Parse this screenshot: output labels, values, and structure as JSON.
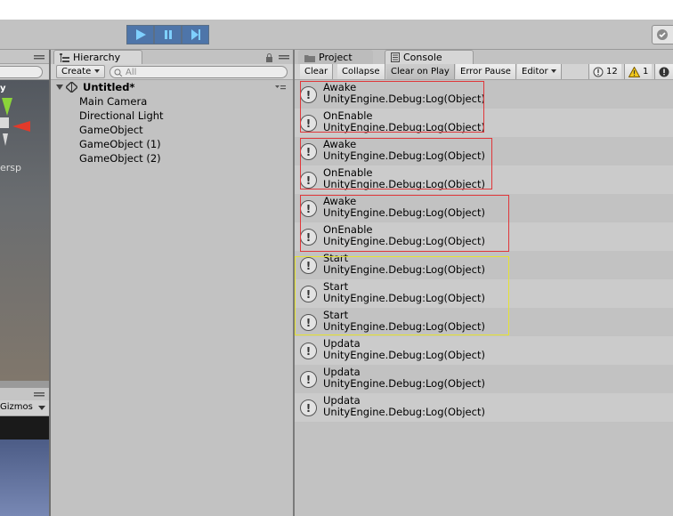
{
  "highlight_colors": {
    "red": "#e0373a",
    "yellow": "#e6e32f"
  },
  "hierarchy": {
    "tab_label": "Hierarchy",
    "create_label": "Create",
    "search_placeholder": "All",
    "scene_name": "Untitled*",
    "items": [
      "Main Camera",
      "Directional Light",
      "GameObject",
      "GameObject (1)",
      "GameObject (2)"
    ]
  },
  "scene_panel": {
    "persp_label": "ersp",
    "axis_label": "y",
    "gizmos_label": "Gizmos"
  },
  "console": {
    "project_tab": "Project",
    "console_tab": "Console",
    "buttons": [
      "Clear",
      "Collapse",
      "Clear on Play",
      "Error Pause",
      "Editor"
    ],
    "log_count": "12",
    "warn_count": "1",
    "entries": [
      {
        "message": "Awake",
        "detail": "UnityEngine.Debug:Log(Object)"
      },
      {
        "message": "OnEnable",
        "detail": "UnityEngine.Debug:Log(Object)"
      },
      {
        "message": "Awake",
        "detail": "UnityEngine.Debug:Log(Object)"
      },
      {
        "message": "OnEnable",
        "detail": "UnityEngine.Debug:Log(Object)"
      },
      {
        "message": "Awake",
        "detail": "UnityEngine.Debug:Log(Object)"
      },
      {
        "message": "OnEnable",
        "detail": "UnityEngine.Debug:Log(Object)"
      },
      {
        "message": "Start",
        "detail": "UnityEngine.Debug:Log(Object)"
      },
      {
        "message": "Start",
        "detail": "UnityEngine.Debug:Log(Object)"
      },
      {
        "message": "Start",
        "detail": "UnityEngine.Debug:Log(Object)"
      },
      {
        "message": "Updata",
        "detail": "UnityEngine.Debug:Log(Object)"
      },
      {
        "message": "Updata",
        "detail": "UnityEngine.Debug:Log(Object)"
      },
      {
        "message": "Updata",
        "detail": "UnityEngine.Debug:Log(Object)"
      }
    ]
  }
}
